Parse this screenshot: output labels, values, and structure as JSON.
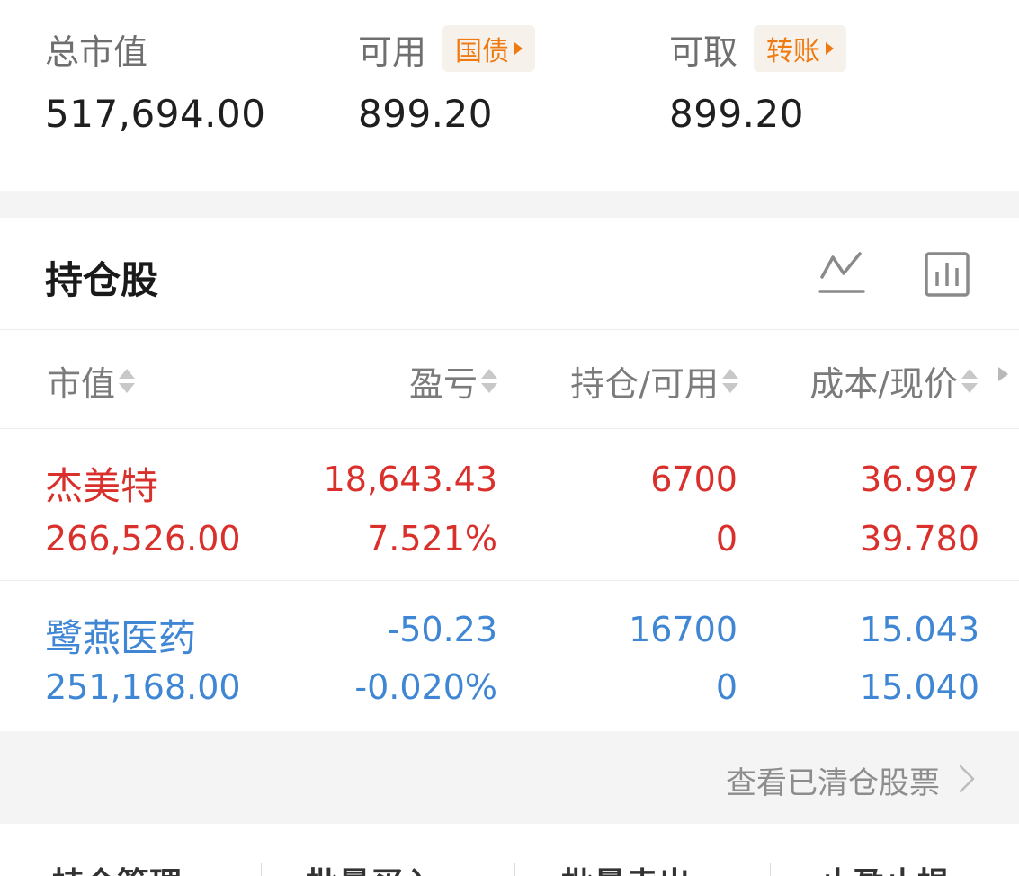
{
  "summary": {
    "total_market_value": {
      "label": "总市值",
      "value": "517,694.00"
    },
    "available": {
      "label": "可用",
      "value": "899.20",
      "pill": "国债"
    },
    "withdrawable": {
      "label": "可取",
      "value": "899.20",
      "pill": "转账"
    }
  },
  "holdings": {
    "title": "持仓股",
    "columns": [
      "市值",
      "盈亏",
      "持仓/可用",
      "成本/现价"
    ],
    "rows": [
      {
        "name": "杰美特",
        "market_value": "266,526.00",
        "pnl": "18,643.43",
        "pnl_pct": "7.521%",
        "position": "6700",
        "available": "0",
        "cost": "36.997",
        "price": "39.780",
        "color": "#d9302c"
      },
      {
        "name": "鹭燕医药",
        "market_value": "251,168.00",
        "pnl": "-50.23",
        "pnl_pct": "-0.020%",
        "position": "16700",
        "available": "0",
        "cost": "15.043",
        "price": "15.040",
        "color": "#3f86d4"
      }
    ]
  },
  "cleared_link": "查看已清仓股票",
  "actions": [
    "持仓管理",
    "批量买入",
    "批量卖出",
    "止盈止损"
  ],
  "colors": {
    "accent": "#f07a12",
    "up": "#d9302c",
    "down": "#3f86d4"
  }
}
